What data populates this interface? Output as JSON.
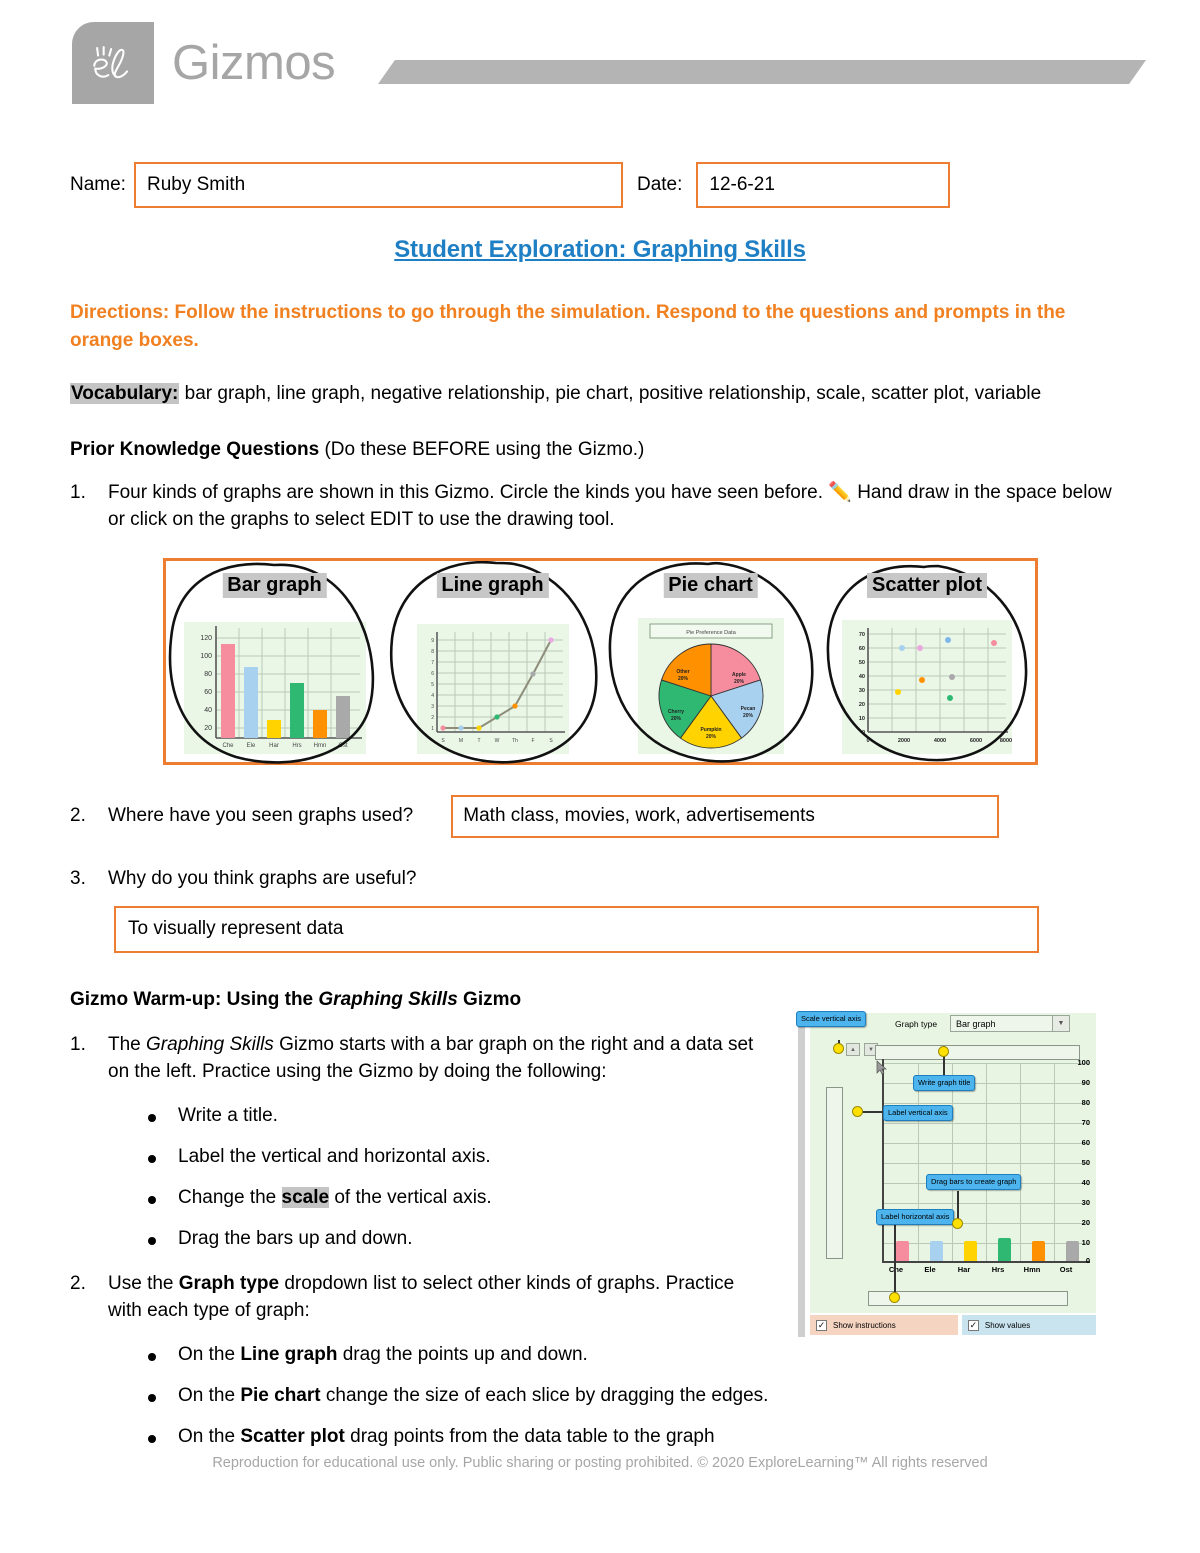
{
  "header": {
    "logo_icon": "gizmos-el-logo-icon",
    "brand": "Gizmos",
    "banner_icon": "gray-parallelogram-banner"
  },
  "form": {
    "name_label": "Name:",
    "name_value": "Ruby Smith",
    "date_label": "Date:",
    "date_value": "12-6-21"
  },
  "title": "Student Exploration: Graphing Skills",
  "directions": "Directions: Follow the instructions to go through the simulation. Respond to the questions and prompts in the orange boxes.",
  "vocabulary": {
    "label": "Vocabulary:",
    "terms": "bar graph, line graph, negative relationship, pie chart, positive relationship, scale, scatter plot, variable"
  },
  "prior_knowledge": {
    "heading": "Prior Knowledge Questions",
    "heading_note": "(Do these BEFORE using the Gizmo.)",
    "q1": {
      "number": "1.",
      "text_a": "Four kinds of graphs are shown in this Gizmo. Circle the kinds you have seen before.",
      "pencil_icon": "pencil-icon",
      "text_b": "Hand draw in the space below or click on the graphs to select EDIT to use the drawing tool."
    },
    "q2": {
      "number": "2.",
      "text": "Where have you seen graphs used?",
      "answer": "Math class, movies, work, advertisements"
    },
    "q3": {
      "number": "3.",
      "text": "Why do you think graphs are useful?",
      "answer": "To visually represent data"
    }
  },
  "figure": {
    "labels": [
      "Bar graph",
      "Line graph",
      "Pie chart",
      "Scatter plot"
    ],
    "circled": [
      true,
      true,
      true,
      true
    ]
  },
  "warmup": {
    "heading_a": "Gizmo Warm-up: Using the ",
    "heading_em": "Graphing Skills",
    "heading_b": " Gizmo",
    "item1": {
      "number": "1.",
      "text_a": "The ",
      "text_em": "Graphing Skills",
      "text_b": " Gizmo starts with a bar graph on the right and a data set on the left. Practice using the Gizmo by doing the following:",
      "bullets": [
        {
          "a": "Write a title.",
          "hl": "",
          "b": ""
        },
        {
          "a": "Label the vertical and horizontal axis.",
          "hl": "",
          "b": ""
        },
        {
          "a": "Change the ",
          "hl": "scale",
          "b": " of the vertical axis."
        },
        {
          "a": "Drag the bars up and down.",
          "hl": "",
          "b": ""
        }
      ]
    },
    "item2": {
      "number": "2.",
      "text_a": "Use the ",
      "text_bold": "Graph type",
      "text_b": " dropdown list to select other kinds of graphs. Practice with each type of graph:",
      "bullets": [
        {
          "a": "On the ",
          "bold": "Line graph",
          "b": " drag the points up and down."
        },
        {
          "a": "On the ",
          "bold": "Pie chart",
          "b": " change the size of each slice by dragging the edges."
        },
        {
          "a": "On the ",
          "bold": "Scatter plot",
          "b": " drag points from the data table to the graph"
        }
      ]
    }
  },
  "gizmo": {
    "graph_type_label": "Graph type",
    "graph_type_value": "Bar graph",
    "dropdown_icon": "chevron-down-icon",
    "spinner_up_icon": "triangle-up-icon",
    "spinner_down_icon": "triangle-down-icon",
    "cursor_icon": "arrow-cursor-icon",
    "callouts": [
      "Scale vertical axis",
      "Write graph title",
      "Label vertical axis",
      "Drag bars to create graph",
      "Label horizontal axis"
    ],
    "y_ticks": [
      "100",
      "90",
      "80",
      "70",
      "60",
      "50",
      "40",
      "30",
      "20",
      "10",
      "0"
    ],
    "x_ticks": [
      "Che",
      "Ele",
      "Har",
      "Hrs",
      "Hmn",
      "Ost"
    ],
    "bar_values": [
      10,
      10,
      10,
      11,
      10,
      10
    ],
    "bar_colors": [
      "#F58D9E",
      "#A8D1F0",
      "#FFD300",
      "#2EB872",
      "#FF9100",
      "#A9A9A9"
    ],
    "checkboxes": [
      {
        "label": "Show instructions",
        "checked": true
      },
      {
        "label": "Show values",
        "checked": true
      }
    ],
    "check_icon": "checkmark-icon"
  },
  "footer": "Reproduction for educational use only. Public sharing or posting prohibited. © 2020 ExploreLearning™ All rights reserved",
  "chart_data": [
    {
      "type": "bar",
      "title": "Bar graph",
      "categories": [
        "Che",
        "Ele",
        "Har",
        "Hrs",
        "Hmn",
        "Ost"
      ],
      "values": [
        118,
        92,
        30,
        70,
        40,
        56
      ],
      "colors": [
        "#F58D9E",
        "#A8D1F0",
        "#FFD300",
        "#2EB872",
        "#FF9100",
        "#A9A9A9"
      ],
      "ylabel": "",
      "xlabel": "",
      "yticks": [
        20,
        40,
        60,
        80,
        100,
        120
      ],
      "ylim": [
        0,
        130
      ],
      "grid": true
    },
    {
      "type": "line",
      "title": "Line graph",
      "x": [
        "S",
        "M",
        "T",
        "W",
        "Th",
        "F",
        "S"
      ],
      "values": [
        1,
        1,
        1,
        2,
        3,
        5.5,
        9
      ],
      "point_colors": [
        "#F58D9E",
        "#A8D1F0",
        "#FFD300",
        "#2EB872",
        "#FF9100",
        "#A9A9A9",
        "#E9A8E0"
      ],
      "ylim": [
        0,
        9
      ],
      "yticks": [
        1,
        2,
        3,
        4,
        5,
        6,
        7,
        8,
        9
      ],
      "grid": true
    },
    {
      "type": "pie",
      "title": "Pie chart",
      "chart_caption": "Pie Preference Data",
      "labels": [
        "Apple",
        "Pecan",
        "Pumpkin",
        "Cherry",
        "Other"
      ],
      "values": [
        20,
        20,
        20,
        20,
        20
      ],
      "value_labels": [
        "20%",
        "20%",
        "20%",
        "20%",
        "20%"
      ],
      "colors": [
        "#F58D9E",
        "#A8D1F0",
        "#FFD300",
        "#2EB872",
        "#FF9100"
      ]
    },
    {
      "type": "scatter",
      "title": "Scatter plot",
      "points": [
        {
          "x": 2900,
          "y": 30,
          "color": "#FFD300"
        },
        {
          "x": 3100,
          "y": 60,
          "color": "#A8D1F0"
        },
        {
          "x": 4000,
          "y": 60,
          "color": "#E9A8E0"
        },
        {
          "x": 4100,
          "y": 36,
          "color": "#FF9100"
        },
        {
          "x": 5300,
          "y": 66,
          "color": "#7FB8E8"
        },
        {
          "x": 5500,
          "y": 38,
          "color": "#A9A9A9"
        },
        {
          "x": 5400,
          "y": 27,
          "color": "#2EB872"
        },
        {
          "x": 7800,
          "y": 64,
          "color": "#F58D9E"
        }
      ],
      "xticks": [
        2000,
        4000,
        6000,
        8000
      ],
      "yticks": [
        10,
        20,
        30,
        40,
        50,
        60,
        70
      ],
      "xlim": [
        0,
        8600
      ],
      "ylim": [
        0,
        72
      ],
      "grid": true
    }
  ]
}
